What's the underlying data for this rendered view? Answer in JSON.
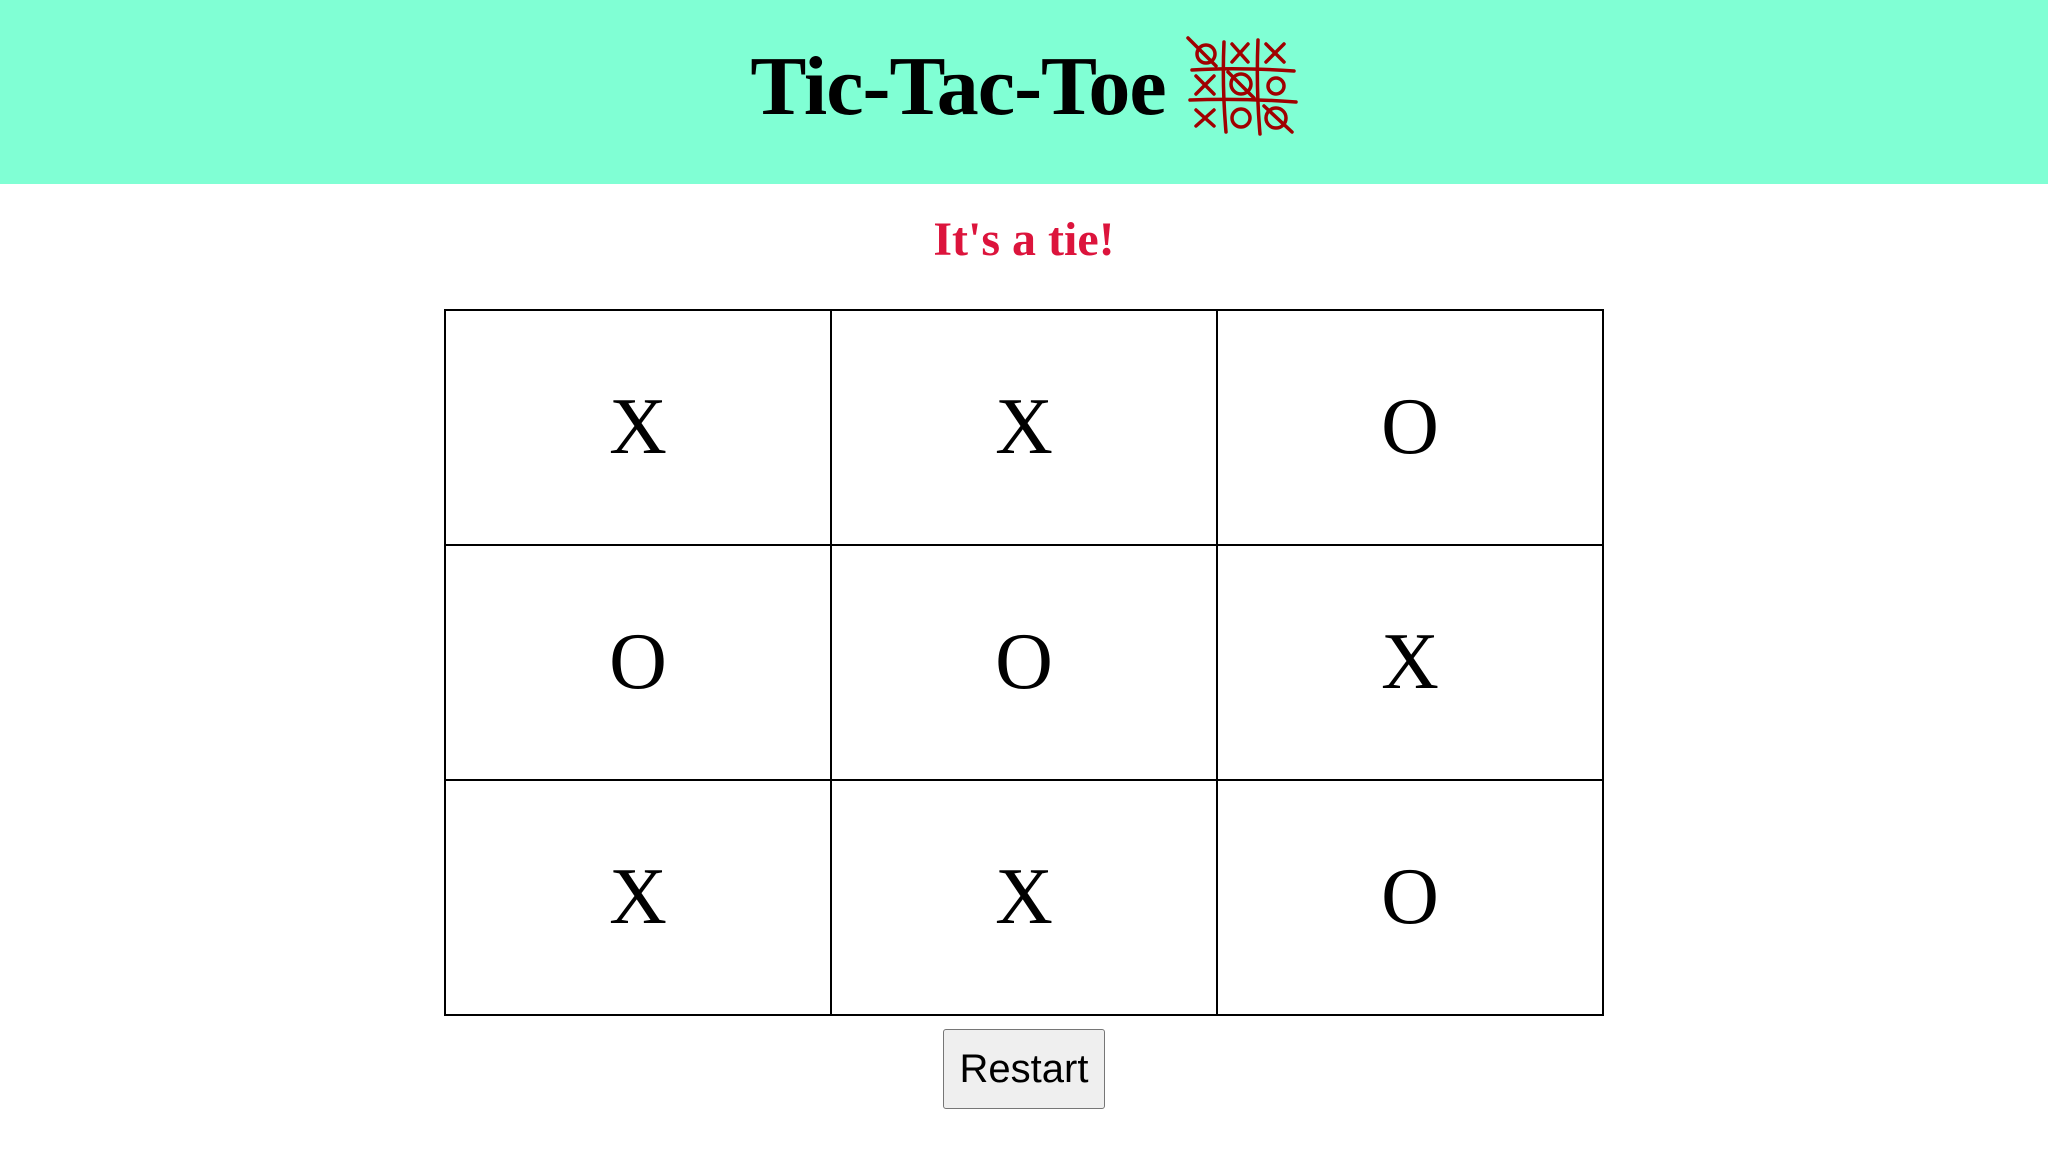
{
  "header": {
    "title": "Tic-Tac-Toe",
    "background_color": "#80ffd4",
    "logo_icon": "tic-tac-toe-icon"
  },
  "status": {
    "text": "It's a tie!",
    "color": "#dc143c"
  },
  "board": {
    "rows": [
      [
        "X",
        "X",
        "O"
      ],
      [
        "O",
        "O",
        "X"
      ],
      [
        "X",
        "X",
        "O"
      ]
    ]
  },
  "controls": {
    "restart_label": "Restart"
  }
}
